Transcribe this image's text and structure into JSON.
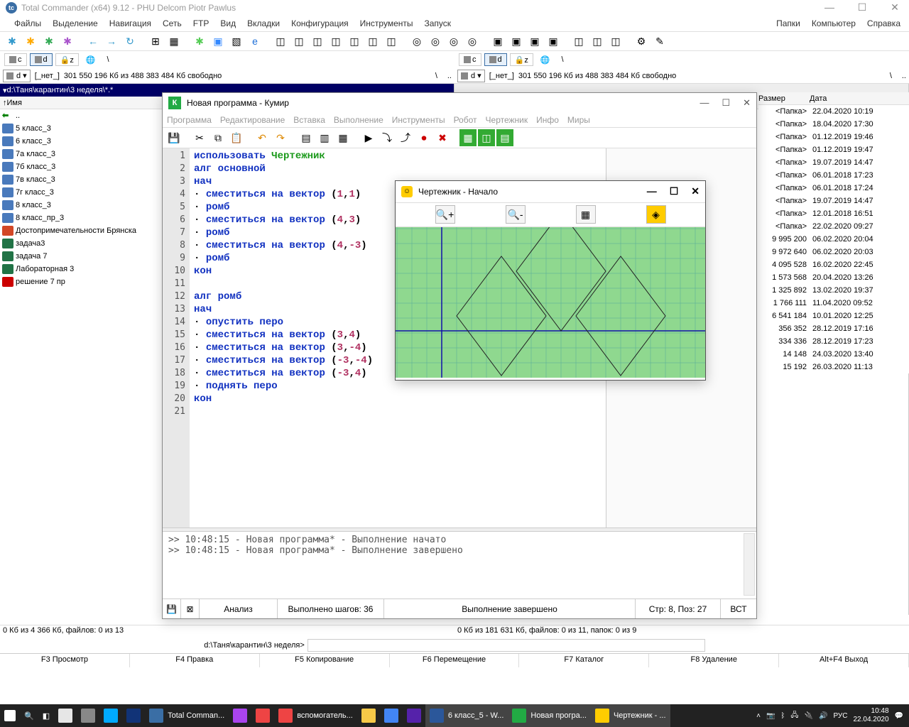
{
  "tc": {
    "title": "Total Commander (x64) 9.12 - PHU Delcom Piotr Pawlus",
    "menus": [
      "Файлы",
      "Выделение",
      "Навигация",
      "Сеть",
      "FTP",
      "Вид",
      "Вкладки",
      "Конфигурация",
      "Инструменты",
      "Запуск"
    ],
    "menus_right": [
      "Папки",
      "Компьютер",
      "Справка"
    ],
    "drives": [
      "c",
      "d",
      "z"
    ],
    "free_space": "301 550 196 Кб из 488 383 484 Кб свободно",
    "free_space_right": "301 550 196 Кб из 488 383 484 Кб свободно",
    "left_path": "d:\\Таня\\карантин\\3 неделя\\*.*",
    "right_none": "[_нет_]",
    "cols": {
      "name": "Имя",
      "size": "Размер",
      "date": "Дата"
    },
    "left_files": [
      {
        "ico": "up",
        "name": "..",
        "size": "",
        "date": ""
      },
      {
        "ico": "doc",
        "name": "5 класс_3",
        "size": "",
        "date": ""
      },
      {
        "ico": "doc",
        "name": "6 класс_3",
        "size": "",
        "date": ""
      },
      {
        "ico": "doc",
        "name": "7а класс_3",
        "size": "",
        "date": ""
      },
      {
        "ico": "doc",
        "name": "7б класс_3",
        "size": "",
        "date": ""
      },
      {
        "ico": "doc",
        "name": "7в класс_3",
        "size": "",
        "date": ""
      },
      {
        "ico": "doc",
        "name": "7г класс_3",
        "size": "",
        "date": ""
      },
      {
        "ico": "doc",
        "name": "8 класс_3",
        "size": "",
        "date": ""
      },
      {
        "ico": "doc",
        "name": "8 класс_пр_3",
        "size": "",
        "date": ""
      },
      {
        "ico": "ppt",
        "name": "Достопримечательности Брянска",
        "size": "",
        "date": ""
      },
      {
        "ico": "xls",
        "name": "задача3",
        "size": "",
        "date": ""
      },
      {
        "ico": "xls",
        "name": "задача 7",
        "size": "",
        "date": ""
      },
      {
        "ico": "xls",
        "name": "Лабораторная 3",
        "size": "",
        "date": ""
      },
      {
        "ico": "pdf",
        "name": "решение 7 пр",
        "size": "",
        "date": ""
      }
    ],
    "right_rows": [
      {
        "size": "<Папка>",
        "date": "22.04.2020 10:19"
      },
      {
        "size": "<Папка>",
        "date": "18.04.2020 17:30"
      },
      {
        "size": "<Папка>",
        "date": "01.12.2019 19:46"
      },
      {
        "size": "<Папка>",
        "date": "01.12.2019 19:47"
      },
      {
        "size": "<Папка>",
        "date": "19.07.2019 14:47"
      },
      {
        "size": "<Папка>",
        "date": "06.01.2018 17:23"
      },
      {
        "size": "<Папка>",
        "date": "06.01.2018 17:24"
      },
      {
        "size": "<Папка>",
        "date": "19.07.2019 14:47"
      },
      {
        "size": "<Папка>",
        "date": "12.01.2018 16:51"
      },
      {
        "size": "<Папка>",
        "date": "22.02.2020 09:27"
      },
      {
        "size": "9 995 200",
        "date": "06.02.2020 20:04"
      },
      {
        "size": "9 972 640",
        "date": "06.02.2020 20:03"
      },
      {
        "size": "4 095 528",
        "date": "16.02.2020 22:45"
      },
      {
        "size": "1 573 568",
        "date": "20.04.2020 13:26"
      },
      {
        "size": "1 325 892",
        "date": "13.02.2020 19:37"
      },
      {
        "size": "1 766 111",
        "date": "11.04.2020 09:52"
      },
      {
        "size": "6 541 184",
        "date": "10.01.2020 12:25"
      },
      {
        "size": "356 352",
        "date": "28.12.2019 17:16"
      },
      {
        "size": "334 336",
        "date": "28.12.2019 17:23"
      },
      {
        "size": "14 148",
        "date": "24.03.2020 13:40"
      },
      {
        "size": "15 192",
        "date": "26.03.2020 11:13"
      }
    ],
    "status_left": "0 Кб из 4 366 Кб, файлов: 0 из 13",
    "status_right": "0 Кб из 181 631 Кб, файлов: 0 из 11, папок: 0 из 9",
    "cmdline_label": "d:\\Таня\\карантин\\3 неделя>",
    "fnbar": [
      "F3 Просмотр",
      "F4 Правка",
      "F5 Копирование",
      "F6 Перемещение",
      "F7 Каталог",
      "F8 Удаление",
      "Alt+F4 Выход"
    ]
  },
  "kumir": {
    "title": "Новая программа - Кумир",
    "menus": [
      "Программа",
      "Редактирование",
      "Вставка",
      "Выполнение",
      "Инструменты",
      "Робот",
      "Чертежник",
      "Инфо",
      "Миры"
    ],
    "code": [
      {
        "n": 1,
        "tokens": [
          [
            "использовать ",
            "kw-blue"
          ],
          [
            "Чертежник",
            "kw-green"
          ]
        ]
      },
      {
        "n": 2,
        "tokens": [
          [
            "алг ",
            "kw-blue"
          ],
          [
            "основной",
            "kw-blue"
          ]
        ]
      },
      {
        "n": 3,
        "tokens": [
          [
            "нач",
            "kw-blue"
          ]
        ]
      },
      {
        "n": 4,
        "tokens": [
          [
            "· ",
            "kw-black"
          ],
          [
            "сместиться на вектор ",
            "kw-blue"
          ],
          [
            "(",
            "kw-black"
          ],
          [
            "1",
            "kw-num"
          ],
          [
            ",",
            "kw-black"
          ],
          [
            "1",
            "kw-num"
          ],
          [
            ")",
            "kw-black"
          ]
        ]
      },
      {
        "n": 5,
        "tokens": [
          [
            "· ",
            "kw-black"
          ],
          [
            "ромб",
            "kw-blue"
          ]
        ]
      },
      {
        "n": 6,
        "tokens": [
          [
            "· ",
            "kw-black"
          ],
          [
            "сместиться на вектор ",
            "kw-blue"
          ],
          [
            "(",
            "kw-black"
          ],
          [
            "4",
            "kw-num"
          ],
          [
            ",",
            "kw-black"
          ],
          [
            "3",
            "kw-num"
          ],
          [
            ")",
            "kw-black"
          ]
        ]
      },
      {
        "n": 7,
        "tokens": [
          [
            "· ",
            "kw-black"
          ],
          [
            "ромб",
            "kw-blue"
          ]
        ]
      },
      {
        "n": 8,
        "tokens": [
          [
            "· ",
            "kw-black"
          ],
          [
            "сместиться на вектор ",
            "kw-blue"
          ],
          [
            "(",
            "kw-black"
          ],
          [
            "4",
            "kw-num"
          ],
          [
            ",",
            "kw-black"
          ],
          [
            "-3",
            "kw-num"
          ],
          [
            ")",
            "kw-black"
          ]
        ]
      },
      {
        "n": 9,
        "tokens": [
          [
            "· ",
            "kw-black"
          ],
          [
            "ромб",
            "kw-blue"
          ]
        ]
      },
      {
        "n": 10,
        "tokens": [
          [
            "кон",
            "kw-blue"
          ]
        ]
      },
      {
        "n": 11,
        "tokens": []
      },
      {
        "n": 12,
        "tokens": [
          [
            "алг ",
            "kw-blue"
          ],
          [
            "ромб",
            "kw-blue"
          ]
        ]
      },
      {
        "n": 13,
        "tokens": [
          [
            "нач",
            "kw-blue"
          ]
        ]
      },
      {
        "n": 14,
        "tokens": [
          [
            "· ",
            "kw-black"
          ],
          [
            "опустить перо",
            "kw-blue"
          ]
        ]
      },
      {
        "n": 15,
        "tokens": [
          [
            "· ",
            "kw-black"
          ],
          [
            "сместиться на вектор ",
            "kw-blue"
          ],
          [
            "(",
            "kw-black"
          ],
          [
            "3",
            "kw-num"
          ],
          [
            ",",
            "kw-black"
          ],
          [
            "4",
            "kw-num"
          ],
          [
            ")",
            "kw-black"
          ]
        ]
      },
      {
        "n": 16,
        "tokens": [
          [
            "· ",
            "kw-black"
          ],
          [
            "сместиться на вектор ",
            "kw-blue"
          ],
          [
            "(",
            "kw-black"
          ],
          [
            "3",
            "kw-num"
          ],
          [
            ",",
            "kw-black"
          ],
          [
            "-4",
            "kw-num"
          ],
          [
            ")",
            "kw-black"
          ]
        ]
      },
      {
        "n": 17,
        "tokens": [
          [
            "· ",
            "kw-black"
          ],
          [
            "сместиться на вектор ",
            "kw-blue"
          ],
          [
            "(",
            "kw-black"
          ],
          [
            "-3",
            "kw-num"
          ],
          [
            ",",
            "kw-black"
          ],
          [
            "-4",
            "kw-num"
          ],
          [
            ")",
            "kw-black"
          ]
        ]
      },
      {
        "n": 18,
        "tokens": [
          [
            "· ",
            "kw-black"
          ],
          [
            "сместиться на вектор ",
            "kw-blue"
          ],
          [
            "(",
            "kw-black"
          ],
          [
            "-3",
            "kw-num"
          ],
          [
            ",",
            "kw-black"
          ],
          [
            "4",
            "kw-num"
          ],
          [
            ")",
            "kw-black"
          ]
        ]
      },
      {
        "n": 19,
        "tokens": [
          [
            "· ",
            "kw-black"
          ],
          [
            "поднять перо",
            "kw-blue"
          ]
        ]
      },
      {
        "n": 20,
        "tokens": [
          [
            "кон",
            "kw-blue"
          ]
        ]
      },
      {
        "n": 21,
        "tokens": []
      }
    ],
    "log": [
      ">> 10:48:15 - Новая программа* - Выполнение начато",
      ">> 10:48:15 - Новая программа* - Выполнение завершено"
    ],
    "status": {
      "analyze": "Анализ",
      "steps": "Выполнено шагов: 36",
      "done": "Выполнение завершено",
      "pos": "Стр: 8, Поз: 27",
      "ins": "ВСТ"
    }
  },
  "draw": {
    "title": "Чертежник - Начало"
  },
  "taskbar": {
    "items": [
      {
        "label": "",
        "color": "#e6e6e6"
      },
      {
        "label": "",
        "color": "#888"
      },
      {
        "label": "",
        "color": "#0af"
      },
      {
        "label": "",
        "color": "#137"
      },
      {
        "label": "Total Comman...",
        "color": "#3a6ea5"
      },
      {
        "label": "",
        "color": "#a4e"
      },
      {
        "label": "",
        "color": "#e44"
      },
      {
        "label": "вспомогатель...",
        "color": "#e44"
      },
      {
        "label": "",
        "color": "#f7c948"
      },
      {
        "label": "",
        "color": "#4285f4"
      },
      {
        "label": "",
        "color": "#52a"
      },
      {
        "label": "6 класс_5 - W...",
        "color": "#2b579a"
      },
      {
        "label": "Новая програ...",
        "color": "#2a4"
      },
      {
        "label": "Чертежник - ...",
        "color": "#fc0"
      }
    ],
    "lang": "РУС",
    "time": "10:48",
    "date": "22.04.2020"
  }
}
